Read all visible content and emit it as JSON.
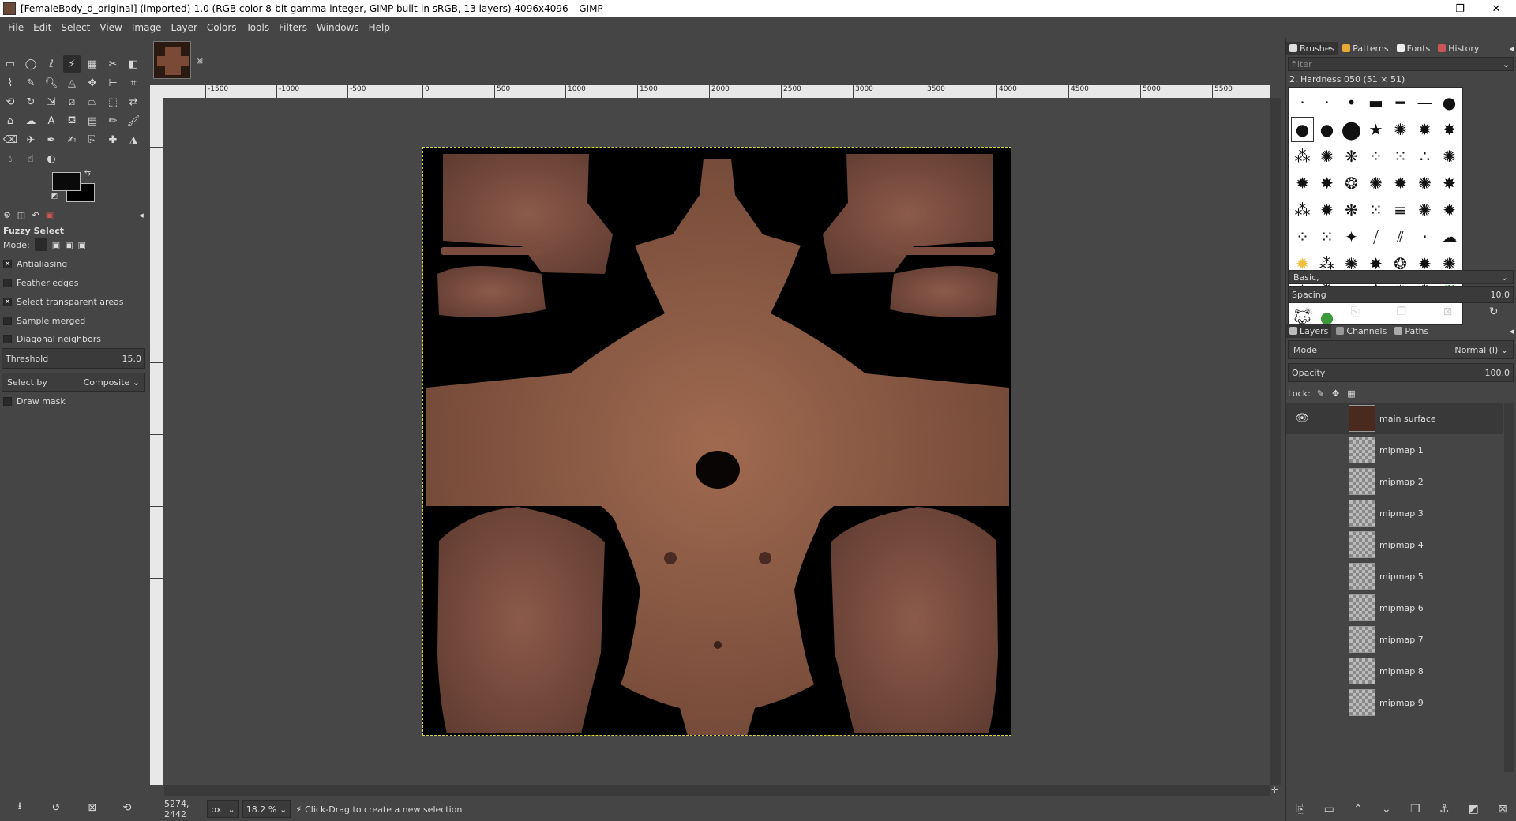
{
  "window": {
    "title": "[FemaleBody_d_original] (imported)-1.0 (RGB color 8-bit gamma integer, GIMP built-in sRGB, 13 layers) 4096x4096 – GIMP",
    "minimize": "—",
    "maximize": "❐",
    "close": "✕"
  },
  "menu": [
    "File",
    "Edit",
    "Select",
    "View",
    "Image",
    "Layer",
    "Colors",
    "Tools",
    "Filters",
    "Windows",
    "Help"
  ],
  "tool_options": {
    "title": "Fuzzy Select",
    "mode_label": "Mode:",
    "antialiasing": "Antialiasing",
    "antialiasing_checked": true,
    "feather_edges": "Feather edges",
    "feather_checked": false,
    "select_transparent": "Select transparent areas",
    "select_transparent_checked": true,
    "sample_merged": "Sample merged",
    "sample_merged_checked": false,
    "diagonal_neighbors": "Diagonal neighbors",
    "diagonal_checked": false,
    "threshold_label": "Threshold",
    "threshold_value": "15.0",
    "select_by_label": "Select by",
    "select_by_value": "Composite",
    "draw_mask": "Draw mask",
    "draw_mask_checked": false
  },
  "ruler": {
    "h_ticks": [
      "-1500",
      "-1000",
      "-500",
      "0",
      "500",
      "1000",
      "1500",
      "2000",
      "2500",
      "3000",
      "3500",
      "4000",
      "4500",
      "5000",
      "5500"
    ]
  },
  "status": {
    "coords": "5274, 2442",
    "unit": "px",
    "zoom": "18.2 %",
    "message": "Click-Drag to create a new selection"
  },
  "brushes_dock": {
    "tabs": [
      "Brushes",
      "Patterns",
      "Fonts",
      "History"
    ],
    "filter_placeholder": "filter",
    "brush_name": "2. Hardness 050 (51 × 51)",
    "preset": "Basic,",
    "spacing_label": "Spacing",
    "spacing_value": "10.0"
  },
  "layers_dock": {
    "tabs": [
      "Layers",
      "Channels",
      "Paths"
    ],
    "mode_label": "Mode",
    "mode_value": "Normal (l)",
    "opacity_label": "Opacity",
    "opacity_value": "100.0",
    "lock_label": "Lock:",
    "layers": [
      "main surface",
      "mipmap 1",
      "mipmap 2",
      "mipmap 3",
      "mipmap 4",
      "mipmap 5",
      "mipmap 6",
      "mipmap 7",
      "mipmap 8",
      "mipmap 9"
    ]
  },
  "colors": {
    "bg": "#454545",
    "skin": "#8a5a44",
    "selection": "#d6d62a"
  }
}
